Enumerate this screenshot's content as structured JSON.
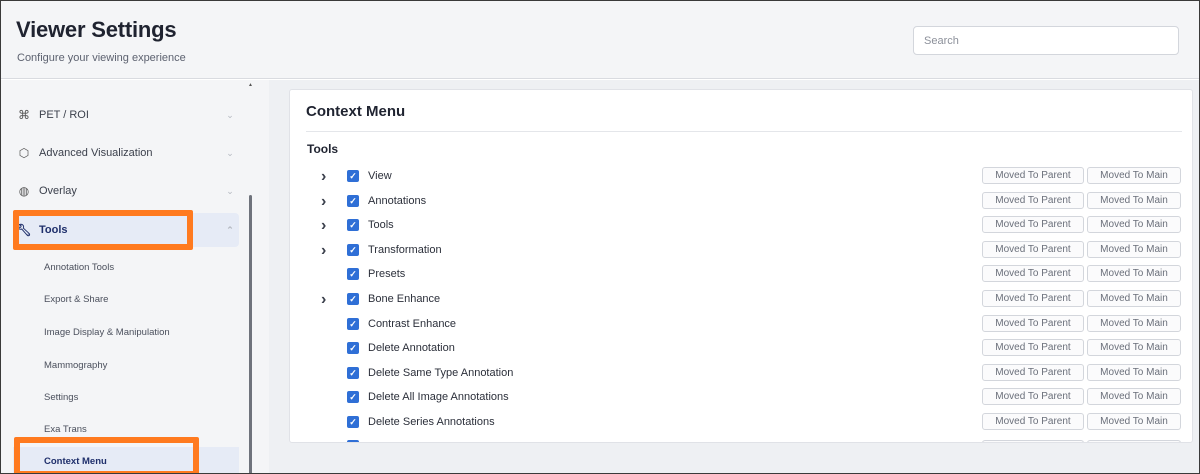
{
  "header": {
    "title": "Viewer Settings",
    "subtitle": "Configure your viewing experience",
    "search_placeholder": "Search"
  },
  "sidebar": {
    "items": [
      {
        "label": "PET / ROI",
        "icon": "pet-roi-icon"
      },
      {
        "label": "Advanced Visualization",
        "icon": "cube-icon"
      },
      {
        "label": "Overlay",
        "icon": "overlay-icon"
      },
      {
        "label": "Tools",
        "icon": "wrench-icon",
        "active": true
      }
    ],
    "subitems": [
      {
        "label": "Annotation Tools"
      },
      {
        "label": "Export & Share"
      },
      {
        "label": "Image Display & Manipulation"
      },
      {
        "label": "Mammography"
      },
      {
        "label": "Settings"
      },
      {
        "label": "Exa Trans"
      },
      {
        "label": "Context Menu",
        "active": true
      }
    ]
  },
  "panel": {
    "title": "Context Menu",
    "section": "Tools",
    "rows": [
      {
        "name": "View",
        "expandable": true,
        "checked": true
      },
      {
        "name": "Annotations",
        "expandable": true,
        "checked": true
      },
      {
        "name": "Tools",
        "expandable": true,
        "checked": true
      },
      {
        "name": "Transformation",
        "expandable": true,
        "checked": true
      },
      {
        "name": "Presets",
        "expandable": false,
        "checked": true
      },
      {
        "name": "Bone Enhance",
        "expandable": true,
        "checked": true
      },
      {
        "name": "Contrast Enhance",
        "expandable": false,
        "checked": true
      },
      {
        "name": "Delete Annotation",
        "expandable": false,
        "checked": true
      },
      {
        "name": "Delete Same Type Annotation",
        "expandable": false,
        "checked": true
      },
      {
        "name": "Delete All Image Annotations",
        "expandable": false,
        "checked": true
      },
      {
        "name": "Delete Series Annotations",
        "expandable": false,
        "checked": true
      }
    ],
    "move_parent_label": "Moved To Parent",
    "move_main_label": "Moved To Main"
  },
  "colors": {
    "accent": "#2f6fd6",
    "highlight": "#ff7a1f",
    "active_bg": "#e6ebf6"
  }
}
